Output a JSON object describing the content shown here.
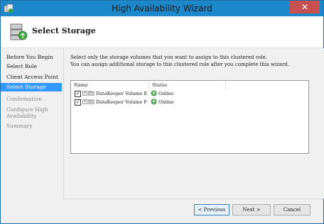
{
  "window": {
    "title": "High Availability Wizard",
    "close_glyph": "✕"
  },
  "header": {
    "title": "Select Storage",
    "icon": "storage-drives-icon"
  },
  "nav": {
    "items": [
      {
        "label": "Before You Begin",
        "state": "normal"
      },
      {
        "label": "Select Role",
        "state": "normal"
      },
      {
        "label": "Client Access Point",
        "state": "normal"
      },
      {
        "label": "Select Storage",
        "state": "active"
      },
      {
        "label": "Confirmation",
        "state": "disabled"
      },
      {
        "label": "Configure High",
        "label2": "Availability",
        "state": "disabled"
      },
      {
        "label": "Summary",
        "state": "disabled"
      }
    ]
  },
  "content": {
    "description_line1": "Select only the storage volumes that you want to assign to this clustered role.",
    "description_line2": "You can assign additional storage to this clustered role after you complete this wizard.",
    "columns": [
      "Name",
      "Status"
    ],
    "volumes": [
      {
        "name": "DataKeeper Volume E",
        "status": "Online",
        "checked": true
      },
      {
        "name": "DataKeeper Volume F",
        "status": "Online",
        "checked": true
      }
    ]
  },
  "buttons": {
    "previous": "< Previous",
    "next": "Next >",
    "cancel": "Cancel"
  },
  "colors": {
    "titlebar": "#1c87c9",
    "active_nav": "#3399ff",
    "close": "#c75050",
    "online": "#3aa53a"
  }
}
